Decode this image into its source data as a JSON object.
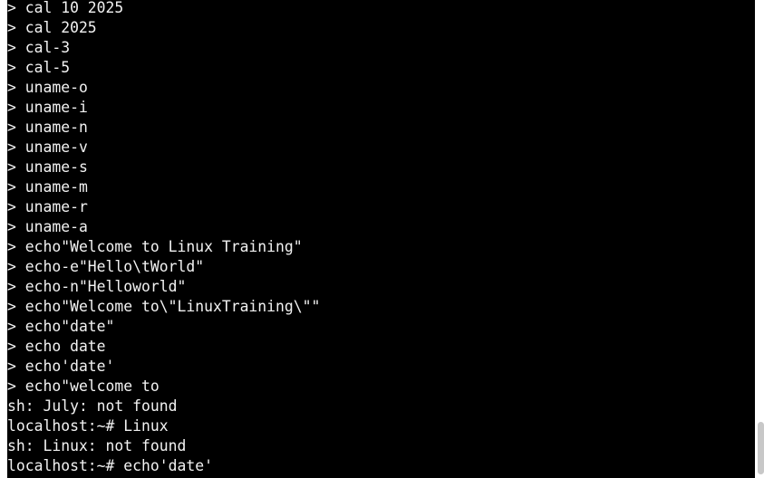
{
  "terminal": {
    "lines": [
      "> cal 10 2025",
      "> cal 2025",
      "> cal-3",
      "> cal-5",
      "> uname-o",
      "> uname-i",
      "> uname-n",
      "> uname-v",
      "> uname-s",
      "> uname-m",
      "> uname-r",
      "> uname-a",
      "> echo\"Welcome to Linux Training\"",
      "> echo-e\"Hello\\tWorld\"",
      "> echo-n\"Helloworld\"",
      "> echo\"Welcome to\\\"LinuxTraining\\\"\"",
      "> echo\"date\"",
      "> echo date",
      "> echo'date'",
      "> echo\"welcome to",
      "sh: July: not found",
      "localhost:~# Linux",
      "sh: Linux: not found",
      "localhost:~# echo'date'"
    ]
  },
  "colors": {
    "background": "#000000",
    "foreground": "#f2f2f2",
    "scrollbar_thumb": "#c8c8c8"
  }
}
